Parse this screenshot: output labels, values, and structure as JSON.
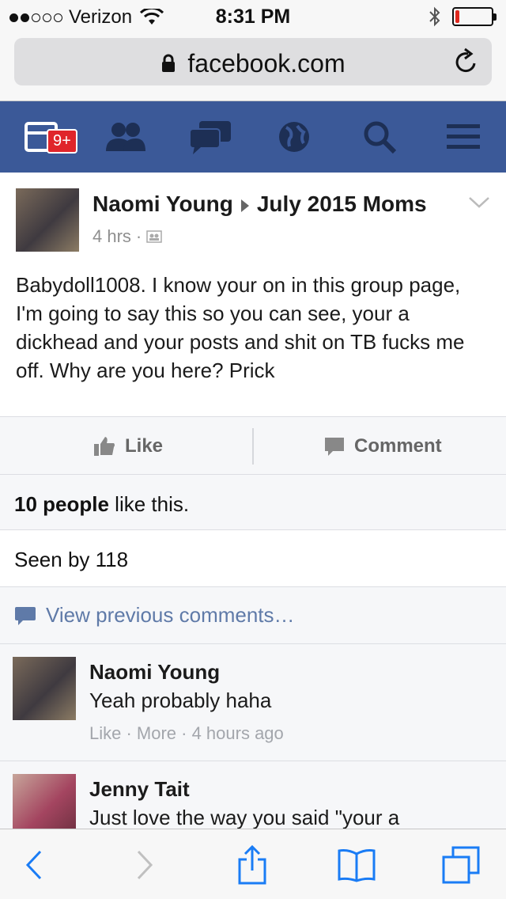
{
  "status": {
    "carrier": "Verizon",
    "time": "8:31 PM",
    "signal_bars": 2,
    "battery_level": 0.12
  },
  "browser": {
    "url": "facebook.com"
  },
  "nav": {
    "notification_badge": "9+"
  },
  "post": {
    "author": "Naomi Young",
    "group": "July 2015 Moms",
    "time": "4 hrs",
    "separator": "·",
    "text": "Babydoll1008. I know your on in this group page, I'm going to say this so you can see, your a dickhead and your posts and shit on TB fucks me off. Why are you here? Prick",
    "like_label": "Like",
    "comment_label": "Comment",
    "likes_count": "10 people",
    "likes_suffix": " like this.",
    "seen": "Seen by 118",
    "view_previous": "View previous comments…"
  },
  "comments": [
    {
      "name": "Naomi Young",
      "text": "Yeah probably haha",
      "meta": "Like · More · 4 hours ago"
    },
    {
      "name": "Jenny Tait",
      "text": "Just love the way you said \"your a"
    }
  ],
  "colors": {
    "fb_blue": "#3b5998",
    "link_blue": "#5f7aa8",
    "badge_red": "#e0252b",
    "safari_blue": "#1a7cf5"
  }
}
